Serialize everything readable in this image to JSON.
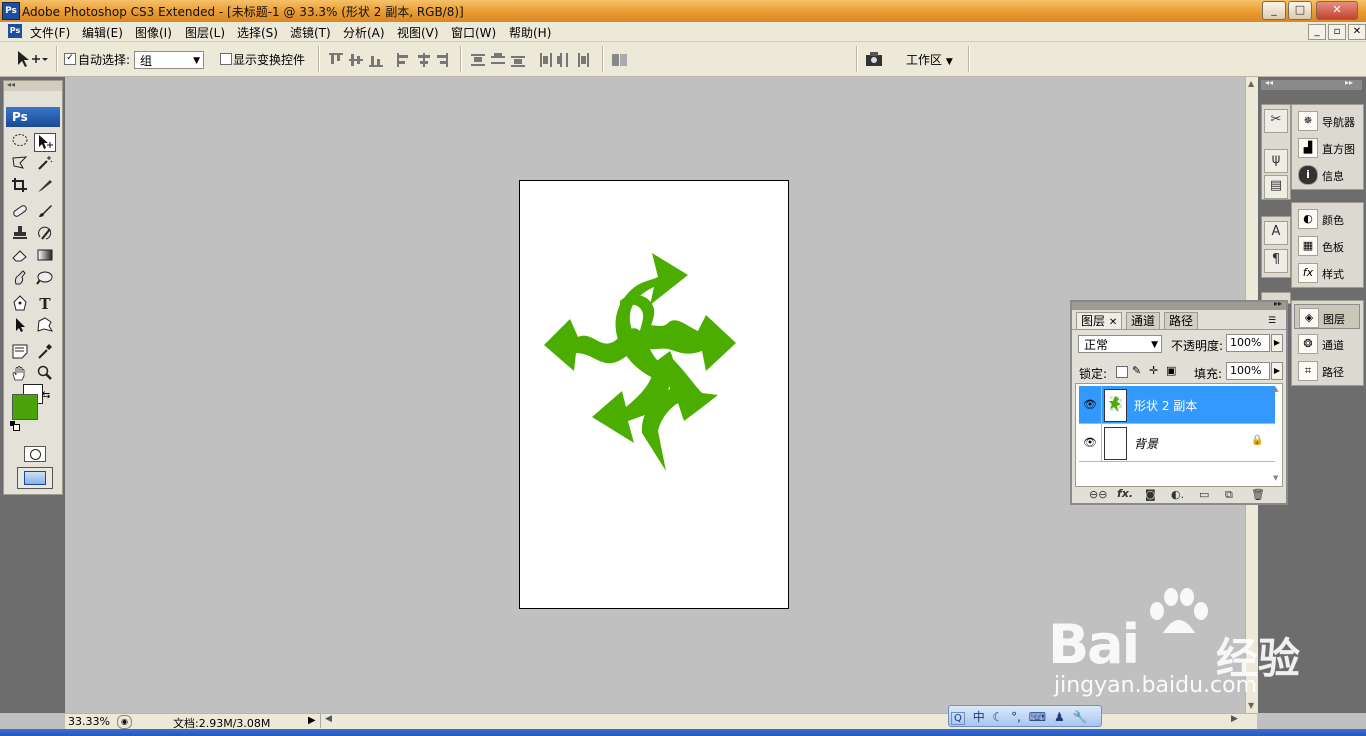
{
  "window": {
    "title": "Adobe Photoshop CS3 Extended - [未标题-1 @ 33.3% (形状 2 副本, RGB/8)]",
    "logo": "Ps",
    "controls": [
      "_",
      "□",
      "✕"
    ]
  },
  "menubar": {
    "items": [
      "文件(F)",
      "编辑(E)",
      "图像(I)",
      "图层(L)",
      "选择(S)",
      "滤镜(T)",
      "分析(A)",
      "视图(V)",
      "窗口(W)",
      "帮助(H)"
    ],
    "doc_controls": [
      "_",
      "▫",
      "✕"
    ]
  },
  "options": {
    "auto_select_label": "自动选择:",
    "auto_select_checked": true,
    "auto_select_value": "组",
    "show_transform_label": "显示变换控件",
    "show_transform_checked": false,
    "workspace_label": "工作区"
  },
  "tools": {
    "logo": "Ps",
    "foreground_color": "#4aa30a",
    "background_color": "#ffffff"
  },
  "document": {
    "shape_color": "#4aad00",
    "background_color": "#ffffff"
  },
  "status": {
    "zoom": "33.33%",
    "doc_info": "文档:2.93M/3.08M"
  },
  "dock": {
    "group1": [
      "导航器",
      "直方图",
      "信息"
    ],
    "group2": [
      "颜色",
      "色板",
      "样式"
    ],
    "group3": [
      "图层",
      "通道",
      "路径"
    ]
  },
  "layers_panel": {
    "tabs": [
      "图层",
      "通道",
      "路径"
    ],
    "blend_mode": "正常",
    "opacity_label": "不透明度:",
    "opacity_value": "100%",
    "lock_label": "锁定:",
    "fill_label": "填充:",
    "fill_value": "100%",
    "layers": [
      {
        "name": "形状 2 副本",
        "active": true
      },
      {
        "name": "背景",
        "active": false
      }
    ]
  },
  "langbar": {
    "items": [
      "中",
      "☾",
      "°,",
      "⌨",
      "♟",
      "🔧"
    ]
  },
  "watermark": {
    "brand": "Bai",
    "brand_suffix": "经验",
    "url": "jingyan.baidu.com"
  }
}
